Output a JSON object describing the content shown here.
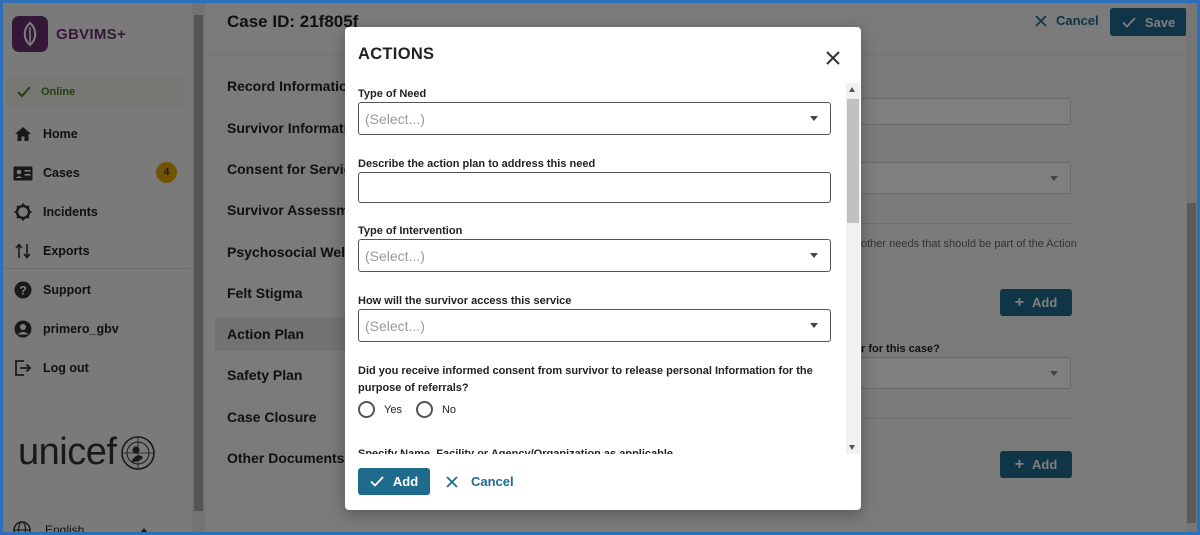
{
  "app": {
    "name": "GBVIMS+"
  },
  "status": {
    "label": "Online"
  },
  "sidebar": {
    "items": [
      {
        "label": "Home",
        "icon": "home-icon"
      },
      {
        "label": "Cases",
        "icon": "cases-icon",
        "badge": "4"
      },
      {
        "label": "Incidents",
        "icon": "incidents-icon"
      },
      {
        "label": "Exports",
        "icon": "exports-icon"
      },
      {
        "label": "Support",
        "icon": "help-icon"
      },
      {
        "label": "primero_gbv",
        "icon": "user-icon"
      },
      {
        "label": "Log out",
        "icon": "logout-icon"
      }
    ],
    "language": "English",
    "org_logo": "unicef"
  },
  "header": {
    "case_id": "Case ID: 21f805f",
    "cancel_label": "Cancel",
    "save_label": "Save"
  },
  "forms": [
    {
      "label": "Record Information"
    },
    {
      "label": "Survivor Information"
    },
    {
      "label": "Consent for Services"
    },
    {
      "label": "Survivor Assessment"
    },
    {
      "label": "Psychosocial Well-being"
    },
    {
      "label": "Felt Stigma"
    },
    {
      "label": "Action Plan",
      "active": true
    },
    {
      "label": "Safety Plan"
    },
    {
      "label": "Case Closure"
    },
    {
      "label": "Other Documents"
    }
  ],
  "background": {
    "note_fragment": "other needs that should be part of the Action",
    "add_label": "Add",
    "question_fragment": "r for this case?"
  },
  "dialog": {
    "title": "ACTIONS",
    "fields": {
      "type_of_need": {
        "label": "Type of Need",
        "placeholder": "(Select...)"
      },
      "action_plan": {
        "label": "Describe the action plan to address this need",
        "value": ""
      },
      "type_of_intervention": {
        "label": "Type of Intervention",
        "placeholder": "(Select...)"
      },
      "access_service": {
        "label": "How will the survivor access this service",
        "placeholder": "(Select...)"
      },
      "consent": {
        "label": "Did you receive informed consent from survivor to release personal Information for the purpose of referrals?",
        "options": [
          "Yes",
          "No"
        ]
      },
      "specify_name": {
        "label": "Specify Name, Facility or Agency/Organization as applicable"
      }
    },
    "add_label": "Add",
    "cancel_label": "Cancel"
  },
  "colors": {
    "brand": "#6b2f6e",
    "primary": "#1f6b8e",
    "badge": "#e0a800",
    "online": "#4f7a28"
  }
}
